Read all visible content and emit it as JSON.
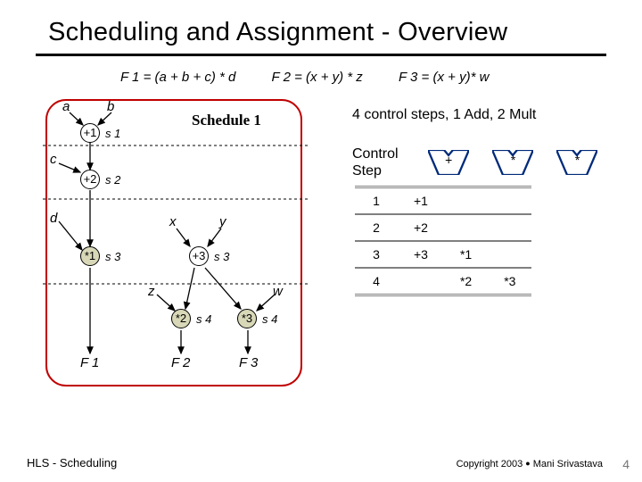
{
  "title": "Scheduling and Assignment - Overview",
  "formulas": {
    "f1": "F 1 = (a + b + c) * d",
    "f2": "F 2 = (x + y) * z",
    "f3": "F 3 = (x + y)* w"
  },
  "schedule_label": "Schedule 1",
  "summary": "4 control steps, 1 Add, 2 Mult",
  "control_step_label": "Control\nStep",
  "resource_headers": {
    "add": "+",
    "mult1": "*",
    "mult2": "*"
  },
  "chart_data": {
    "type": "table",
    "title": "Schedule 1 resource usage",
    "columns": [
      "Control Step",
      "+",
      "*",
      "*"
    ],
    "rows": [
      {
        "step": 1,
        "add": "+1",
        "mult1": "",
        "mult2": ""
      },
      {
        "step": 2,
        "add": "+2",
        "mult1": "",
        "mult2": ""
      },
      {
        "step": 3,
        "add": "+3",
        "mult1": "*1",
        "mult2": ""
      },
      {
        "step": 4,
        "add": "",
        "mult1": "*2",
        "mult2": "*3"
      }
    ]
  },
  "diagram": {
    "inputs": {
      "a": "a",
      "b": "b",
      "c": "c",
      "d": "d",
      "x": "x",
      "y": "y",
      "z": "z",
      "w": "w"
    },
    "outputs": {
      "F1": "F 1",
      "F2": "F 2",
      "F3": "F 3"
    },
    "ops": {
      "plus1": "+1",
      "plus2": "+2",
      "plus3": "+3",
      "mul1": "*1",
      "mul2": "*2",
      "mul3": "*3"
    },
    "steps": {
      "s1": "s 1",
      "s2": "s 2",
      "s3a": "s 3",
      "s3b": "s 3",
      "s4a": "s 4",
      "s4b": "s 4"
    }
  },
  "footer": {
    "left": "HLS - Scheduling",
    "right_prefix": "Copyright 2003 ",
    "right_suffix": " Mani Srivastava",
    "pagenum": "4"
  }
}
